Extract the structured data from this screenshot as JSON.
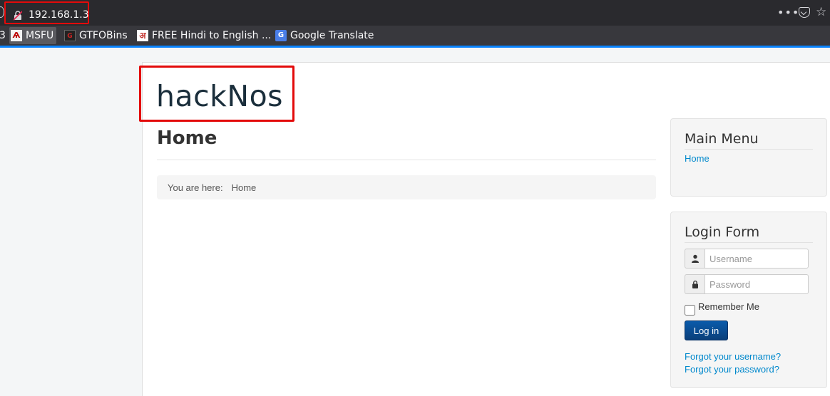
{
  "browser": {
    "url": "192.168.1.3",
    "bookmarks": [
      {
        "label": "MSFU",
        "icon": "msfu-icon"
      },
      {
        "label": "GTFOBins",
        "icon": "gtfobins-icon"
      },
      {
        "label": "FREE Hindi to English ...",
        "icon": "hindi-icon"
      },
      {
        "label": "Google Translate",
        "icon": "google-translate-icon"
      }
    ],
    "bookmark_fragment": "3"
  },
  "site": {
    "brand": "hackNos"
  },
  "main": {
    "heading": "Home",
    "breadcrumb_label": "You are here:",
    "breadcrumb_item": "Home"
  },
  "sidebar": {
    "main_menu_title": "Main Menu",
    "main_menu_items": [
      "Home"
    ],
    "login_title": "Login Form",
    "username_placeholder": "Username",
    "password_placeholder": "Password",
    "remember_label": "Remember Me",
    "login_button": "Log in",
    "forgot_username": "Forgot your username?",
    "forgot_password": "Forgot your password?"
  },
  "colors": {
    "highlight": "#e30a0a",
    "link": "#0088cc",
    "button": "#0a4d92"
  }
}
